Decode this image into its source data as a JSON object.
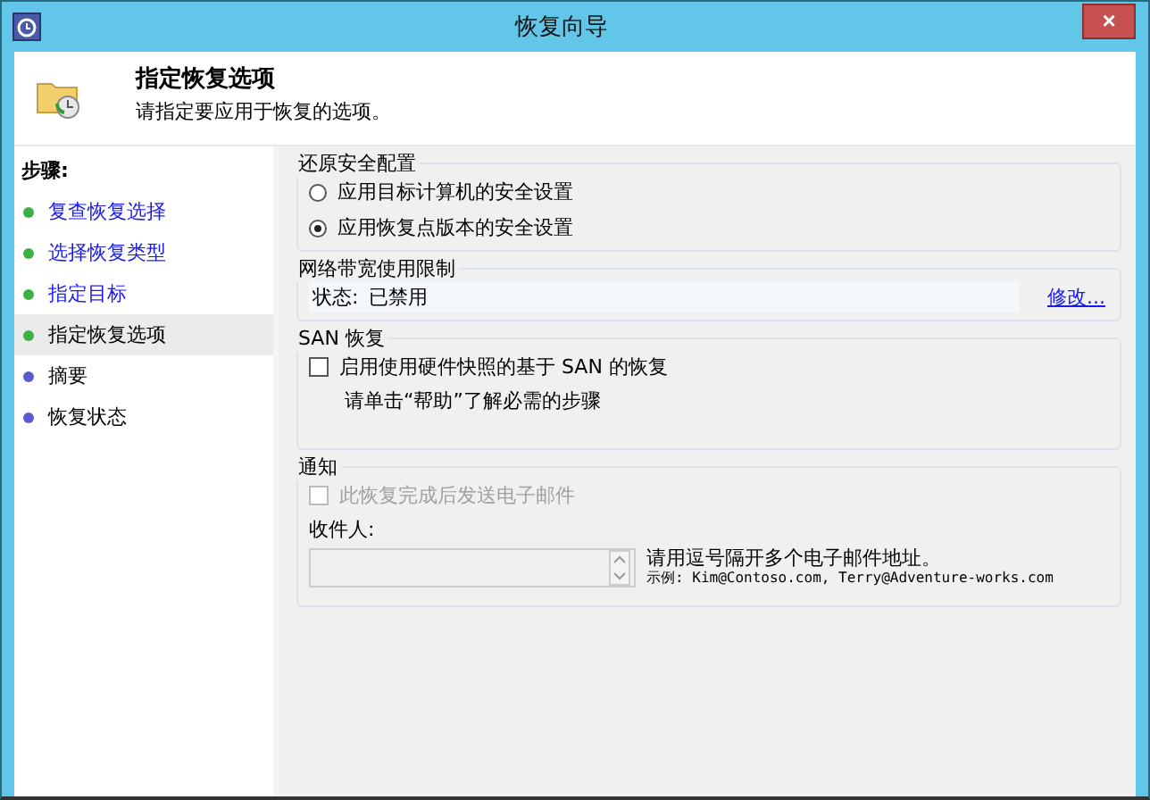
{
  "window": {
    "title": "恢复向导",
    "close": "×"
  },
  "header": {
    "title": "指定恢复选项",
    "subtitle": "请指定要应用于恢复的选项。"
  },
  "sidebar": {
    "heading": "步骤:",
    "items": [
      {
        "label": "复查恢复选择",
        "color": "#3cb043",
        "link": true,
        "selected": false
      },
      {
        "label": "选择恢复类型",
        "color": "#3cb043",
        "link": true,
        "selected": false
      },
      {
        "label": "指定目标",
        "color": "#3cb043",
        "link": true,
        "selected": false
      },
      {
        "label": "指定恢复选项",
        "color": "#3cb043",
        "link": false,
        "selected": true
      },
      {
        "label": "摘要",
        "color": "#5a5acd",
        "link": false,
        "selected": false
      },
      {
        "label": "恢复状态",
        "color": "#5a5acd",
        "link": false,
        "selected": false
      }
    ]
  },
  "security": {
    "title": "还原安全配置",
    "options": [
      {
        "label": "应用目标计算机的安全设置",
        "selected": false
      },
      {
        "label": "应用恢复点版本的安全设置",
        "selected": true
      }
    ]
  },
  "bandwidth": {
    "title": "网络带宽使用限制",
    "status_label": "状态:",
    "status_value": "已禁用",
    "link": "修改..."
  },
  "san": {
    "title": "SAN 恢复",
    "checkbox": {
      "label": "启用使用硬件快照的基于 SAN 的恢复",
      "checked": false
    },
    "hint": "请单击“帮助”了解必需的步骤"
  },
  "notification": {
    "title": "通知",
    "checkbox": {
      "label": "此恢复完成后发送电子邮件",
      "checked": false,
      "disabled": true
    },
    "recipient_label": "收件人:",
    "hint": "请用逗号隔开多个电子邮件地址。",
    "example": "示例: Kim@Contoso.com, Terry@Adventure-works.com"
  }
}
